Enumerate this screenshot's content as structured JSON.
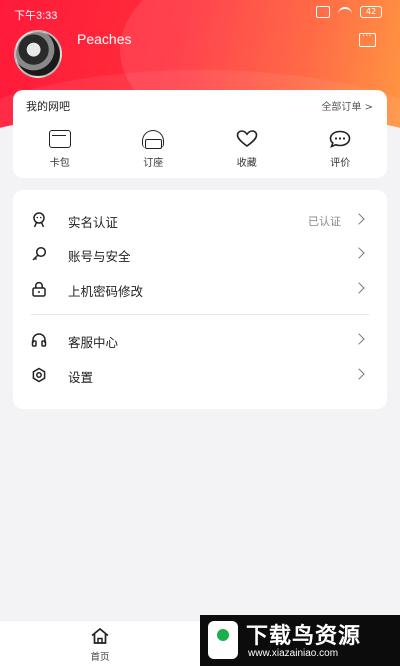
{
  "status_bar": {
    "time": "下午3:33",
    "battery": "42"
  },
  "profile": {
    "username": "Peaches"
  },
  "orders_card": {
    "title": "我的网吧",
    "all_orders": "全部订单 >",
    "items": [
      {
        "label": "卡包",
        "icon": "wallet-icon"
      },
      {
        "label": "订座",
        "icon": "headset-icon"
      },
      {
        "label": "收藏",
        "icon": "heart-icon"
      },
      {
        "label": "评价",
        "icon": "chat-icon"
      }
    ]
  },
  "menu": {
    "items": [
      {
        "label": "实名认证",
        "value": "已认证",
        "icon": "id-badge-icon"
      },
      {
        "label": "账号与安全",
        "value": "",
        "icon": "key-icon"
      },
      {
        "label": "上机密码修改",
        "value": "",
        "icon": "lock-icon"
      },
      {
        "label": "客服中心",
        "value": "",
        "icon": "headphones-icon"
      },
      {
        "label": "设置",
        "value": "",
        "icon": "settings-icon"
      }
    ]
  },
  "bottom_nav": {
    "home_label": "首页"
  },
  "watermark": {
    "title": "下载鸟资源",
    "url": "www.xiazainiao.com"
  }
}
